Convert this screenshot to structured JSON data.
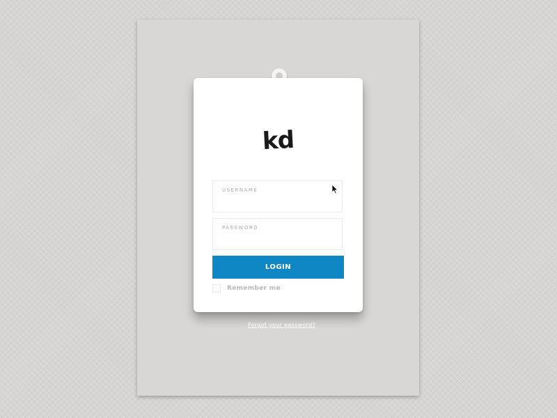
{
  "logo": {
    "text": "kd"
  },
  "form": {
    "username_label": "USERNAME",
    "password_label": "PASSWORD",
    "login_label": "LOGIN",
    "remember_label": "Remember me"
  },
  "footer": {
    "forgot_link": "Forgot your password?"
  },
  "colors": {
    "background": "#d6d5d3",
    "paper": "#d8d7d5",
    "card": "#ffffff",
    "accent": "#0e87c4"
  },
  "icons": {
    "cursor": "arrow-cursor-icon"
  }
}
